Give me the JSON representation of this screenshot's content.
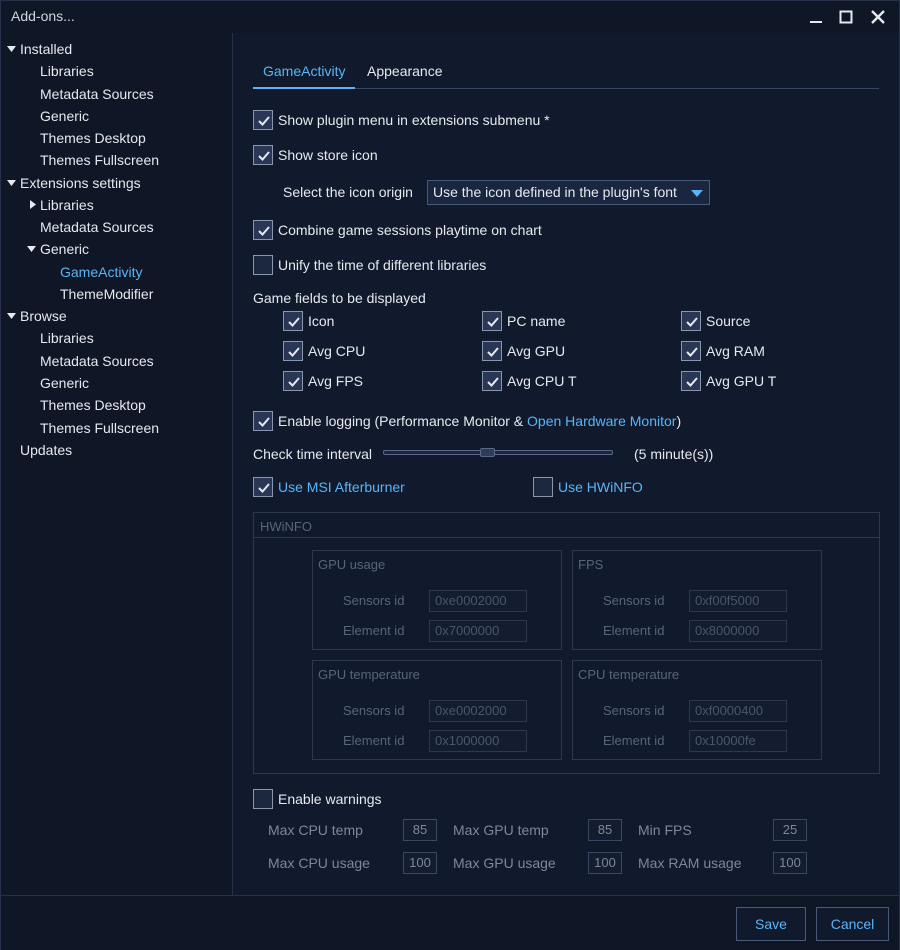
{
  "window": {
    "title": "Add-ons..."
  },
  "sidebar": {
    "items": [
      {
        "label": "Installed",
        "level": 0,
        "expanded": true
      },
      {
        "label": "Libraries",
        "level": 1
      },
      {
        "label": "Metadata Sources",
        "level": 1
      },
      {
        "label": "Generic",
        "level": 1
      },
      {
        "label": "Themes Desktop",
        "level": 1
      },
      {
        "label": "Themes Fullscreen",
        "level": 1
      },
      {
        "label": "Extensions settings",
        "level": 0,
        "expanded": true
      },
      {
        "label": "Libraries",
        "level": 1,
        "collapsed": true
      },
      {
        "label": "Metadata Sources",
        "level": 1
      },
      {
        "label": "Generic",
        "level": 1,
        "expanded": true
      },
      {
        "label": "GameActivity",
        "level": 2,
        "selected": true
      },
      {
        "label": "ThemeModifier",
        "level": 2
      },
      {
        "label": "Browse",
        "level": 0,
        "expanded": true
      },
      {
        "label": "Libraries",
        "level": 1
      },
      {
        "label": "Metadata Sources",
        "level": 1
      },
      {
        "label": "Generic",
        "level": 1
      },
      {
        "label": "Themes Desktop",
        "level": 1
      },
      {
        "label": "Themes Fullscreen",
        "level": 1
      },
      {
        "label": "Updates",
        "level": 0
      }
    ]
  },
  "tabs": [
    {
      "label": "GameActivity",
      "active": true
    },
    {
      "label": "Appearance",
      "active": false
    }
  ],
  "settings": {
    "show_plugin_menu": {
      "label": "Show plugin menu in extensions submenu *",
      "checked": true
    },
    "show_store_icon": {
      "label": "Show store icon",
      "checked": true
    },
    "icon_origin": {
      "label": "Select the icon origin",
      "value": "Use the icon defined in the plugin's font"
    },
    "combine_sessions": {
      "label": "Combine game sessions playtime on chart",
      "checked": true
    },
    "unify_time": {
      "label": "Unify the time of different libraries",
      "checked": false
    },
    "fields_heading": "Game fields to be displayed",
    "fields": [
      {
        "label": "Icon",
        "checked": true
      },
      {
        "label": "PC name",
        "checked": true
      },
      {
        "label": "Source",
        "checked": true
      },
      {
        "label": "Avg CPU",
        "checked": true
      },
      {
        "label": "Avg GPU",
        "checked": true
      },
      {
        "label": "Avg RAM",
        "checked": true
      },
      {
        "label": "Avg FPS",
        "checked": true
      },
      {
        "label": "Avg CPU T",
        "checked": true
      },
      {
        "label": "Avg GPU T",
        "checked": true
      }
    ],
    "enable_logging": {
      "label_prefix": "Enable logging (Performance Monitor & ",
      "label_link": "Open Hardware Monitor",
      "label_suffix": ")",
      "checked": true
    },
    "interval": {
      "label": "Check time interval",
      "value_text": "(5 minute(s))",
      "fraction": 0.45
    },
    "use_msi": {
      "label": "Use MSI Afterburner",
      "checked": true
    },
    "use_hwinfo": {
      "label": "Use HWiNFO",
      "checked": false
    }
  },
  "hwinfo": {
    "title": "HWiNFO",
    "sensors_label": "Sensors id",
    "element_label": "Element id",
    "groups": [
      {
        "title": "GPU usage",
        "sensors": "0xe0002000",
        "element": "0x7000000"
      },
      {
        "title": "FPS",
        "sensors": "0xf00f5000",
        "element": "0x8000000"
      },
      {
        "title": "GPU temperature",
        "sensors": "0xe0002000",
        "element": "0x1000000"
      },
      {
        "title": "CPU temperature",
        "sensors": "0xf0000400",
        "element": "0x10000fe"
      }
    ]
  },
  "warnings": {
    "label": "Enable warnings",
    "checked": false,
    "fields": [
      {
        "label": "Max CPU temp",
        "value": "85"
      },
      {
        "label": "Max GPU temp",
        "value": "85"
      },
      {
        "label": "Min FPS",
        "value": "25"
      },
      {
        "label": "Max CPU usage",
        "value": "100"
      },
      {
        "label": "Max GPU usage",
        "value": "100"
      },
      {
        "label": "Max RAM usage",
        "value": "100"
      }
    ]
  },
  "footer": {
    "save": "Save",
    "cancel": "Cancel"
  }
}
